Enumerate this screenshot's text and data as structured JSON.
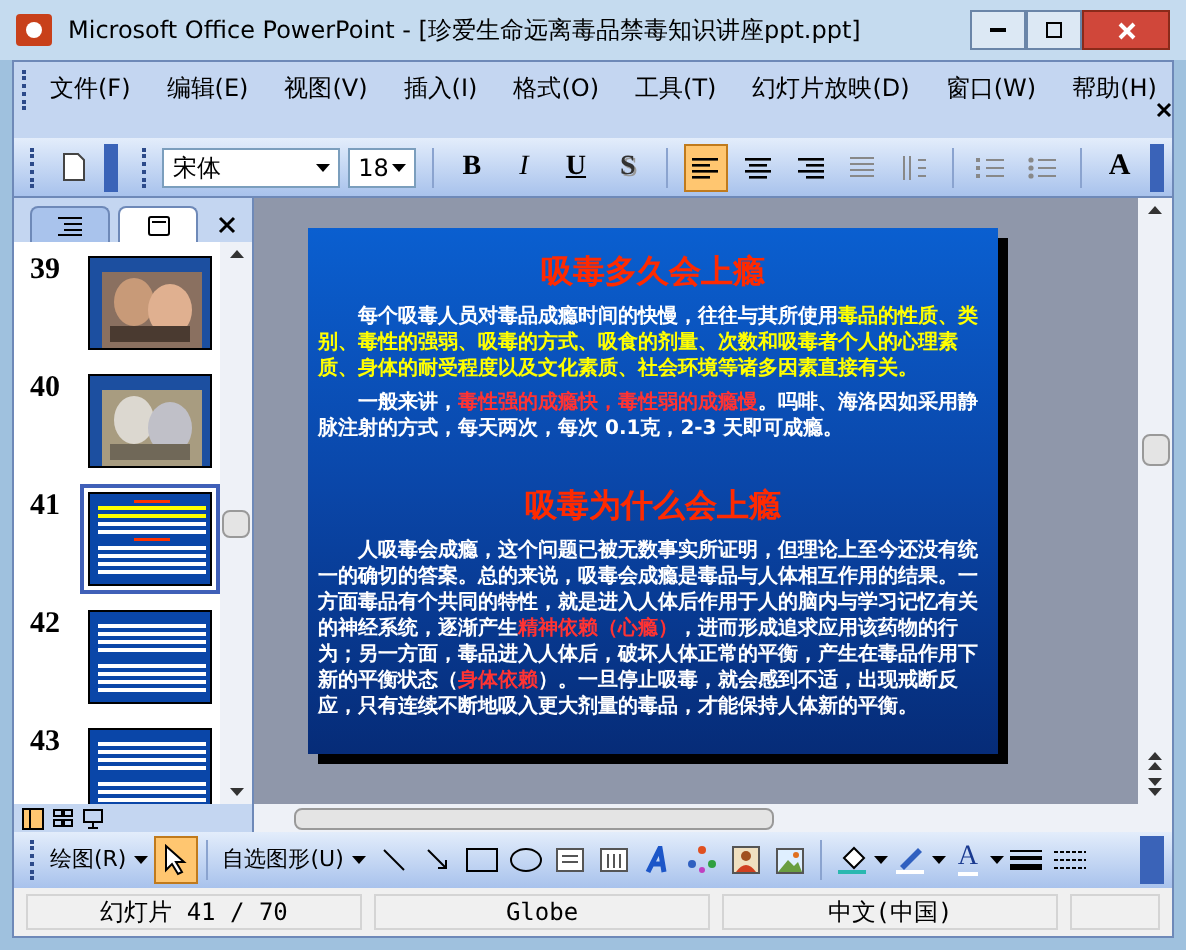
{
  "window": {
    "title": "Microsoft Office PowerPoint - [珍爱生命远离毒品禁毒知识讲座ppt.ppt]"
  },
  "menu": [
    "文件(F)",
    "编辑(E)",
    "视图(V)",
    "插入(I)",
    "格式(O)",
    "工具(T)",
    "幻灯片放映(D)",
    "窗口(W)",
    "帮助(H)"
  ],
  "format_toolbar": {
    "font": "宋体",
    "size": "18",
    "buttons": [
      {
        "kind": "bold",
        "label": "B"
      },
      {
        "kind": "italic",
        "label": "I"
      },
      {
        "kind": "underline",
        "label": "U"
      },
      {
        "kind": "shadow",
        "label": "S"
      }
    ],
    "align_left_selected": true,
    "grow_label": "A"
  },
  "panel_tabs": [
    {
      "kind": "outline",
      "selected": false
    },
    {
      "kind": "slides",
      "selected": true
    }
  ],
  "slides": [
    {
      "number": "39",
      "selected": false
    },
    {
      "number": "40",
      "selected": false
    },
    {
      "number": "41",
      "kind": "text",
      "selected": true
    },
    {
      "number": "42",
      "kind": "text",
      "selected": false
    },
    {
      "number": "43",
      "kind": "text",
      "selected": false
    }
  ],
  "slide": {
    "sections": [
      {
        "heading": "吸毒多久会上瘾",
        "paragraphs": [
          [
            {
              "text": "每个吸毒人员对毒品成瘾时间的快慢，往往与其所使用",
              "color": "#ffffff"
            },
            {
              "text": "毒品的性质、类别、毒性的强弱、吸毒的方式、吸食的剂量、次数和吸毒者个人的心理素质、身体的耐受程度以及文化素质、社会环境等诸多因素直接有关。",
              "color": "#ffff00"
            }
          ],
          [
            {
              "text": "一般来讲，",
              "color": "#ffffff"
            },
            {
              "text": "毒性强的成瘾快，毒性弱的成瘾慢",
              "color": "#ff3333"
            },
            {
              "text": "。吗啡、海洛因如采用静脉注射的方式，每天两次，每次 0.1克，2-3 天即可成瘾。",
              "color": "#ffffff"
            }
          ]
        ]
      },
      {
        "heading": "吸毒为什么会上瘾",
        "paragraphs": [
          [
            {
              "text": "人吸毒会成瘾，这个问题已被无数事实所证明，但理论上至今还没有统一的确切的答案。总的来说，吸毒会成瘾是毒品与人体相互作用的结果。一方面毒品有个共同的特性，就是进入人体后作用于人的脑内与学习记忆有关的神经系统，逐渐产生",
              "color": "#ffffff"
            },
            {
              "text": "精神依赖（心瘾）",
              "color": "#ff3333"
            },
            {
              "text": "，进而形成追求应用该药物的行为；另一方面，毒品进入人体后，破坏人体正常的平衡，产生在毒品作用下新的平衡状态（",
              "color": "#ffffff"
            },
            {
              "text": "身体依赖",
              "color": "#ff3333"
            },
            {
              "text": "）。一旦停止吸毒，就会感到不适，出现戒断反应，只有连续不断地吸入更大剂量的毒品，才能保持人体新的平衡。",
              "color": "#ffffff"
            }
          ]
        ]
      }
    ]
  },
  "drawing_toolbar": {
    "draw_menu": "绘图(R)",
    "autoshapes_menu": "自选图形(U)",
    "text_color_label": "A"
  },
  "status_bar": [
    "幻灯片 41 / 70",
    "Globe",
    "中文(中国)"
  ]
}
